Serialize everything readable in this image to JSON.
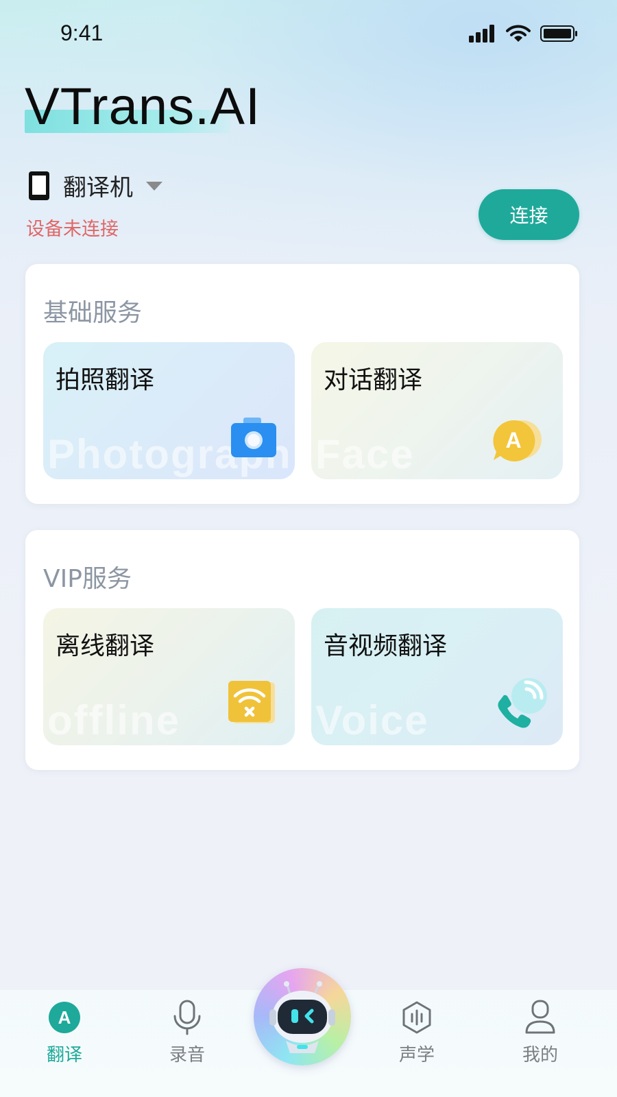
{
  "status_bar": {
    "time": "9:41"
  },
  "app": {
    "brand": "VTrans.AI"
  },
  "device": {
    "name": "翻译机",
    "status": "设备未连接",
    "connect_label": "连接"
  },
  "basic_services": {
    "title": "基础服务",
    "items": [
      {
        "label": "拍照翻译",
        "watermark": "Photograph",
        "icon": "camera-icon"
      },
      {
        "label": "对话翻译",
        "watermark": "Face",
        "icon": "chat-a-icon"
      }
    ]
  },
  "vip_services": {
    "title": "VIP服务",
    "items": [
      {
        "label": "离线翻译",
        "watermark": "offline",
        "icon": "wifi-off-icon"
      },
      {
        "label": "音视频翻译",
        "watermark": "Voice",
        "icon": "phone-call-icon"
      }
    ]
  },
  "tabbar": {
    "items": [
      {
        "label": "翻译",
        "icon": "translate-icon",
        "active": true
      },
      {
        "label": "录音",
        "icon": "microphone-icon",
        "active": false
      },
      {
        "label": "",
        "icon": "robot-assistant-icon",
        "active": false
      },
      {
        "label": "声学",
        "icon": "acoustics-icon",
        "active": false
      },
      {
        "label": "我的",
        "icon": "profile-icon",
        "active": false
      }
    ]
  },
  "colors": {
    "accent": "#1fa99a",
    "warning": "#e06767",
    "camera_blue": "#2a8ff0",
    "chat_yellow": "#f3c53a"
  }
}
